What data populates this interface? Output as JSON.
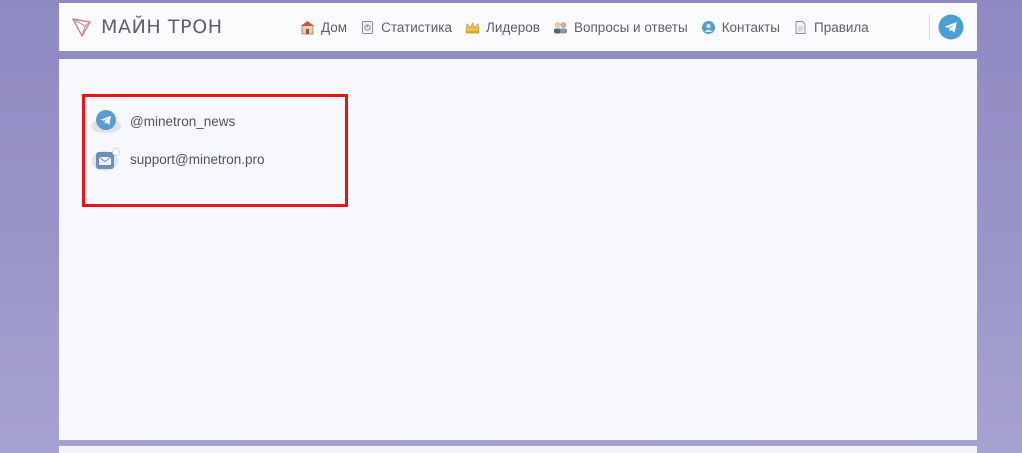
{
  "header": {
    "logo_text": "МАЙН ТРОН",
    "nav": [
      {
        "label": "Дом",
        "icon": "home-icon"
      },
      {
        "label": "Статистика",
        "icon": "statistics-icon"
      },
      {
        "label": "Лидеров",
        "icon": "crown-icon"
      },
      {
        "label": "Вопросы и ответы",
        "icon": "faq-icon"
      },
      {
        "label": "Контакты",
        "icon": "contacts-icon"
      },
      {
        "label": "Правила",
        "icon": "document-icon"
      }
    ],
    "telegram_icon": "telegram-icon"
  },
  "contacts": [
    {
      "text": "@minetron_news",
      "icon": "telegram-icon"
    },
    {
      "text": "support@minetron.pro",
      "icon": "mail-icon"
    }
  ],
  "colors": {
    "background": "#948ec6",
    "card": "#f7f8fb",
    "highlight": "#e8141b",
    "accent_blue": "#4a9fd3"
  }
}
